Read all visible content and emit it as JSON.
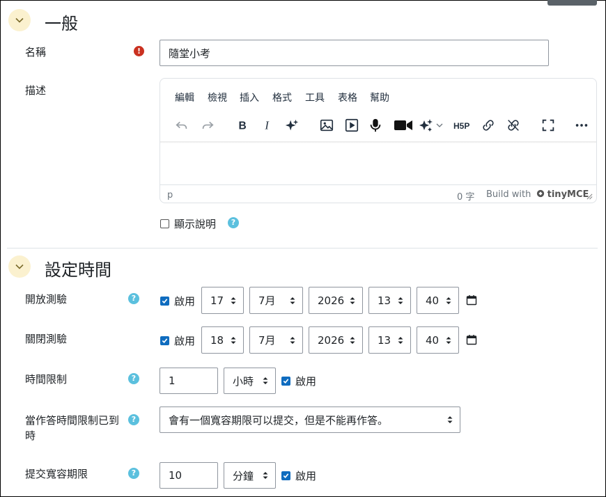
{
  "sections": {
    "general": {
      "title": "一般"
    },
    "timing": {
      "title": "設定時間"
    }
  },
  "fields": {
    "name": {
      "label": "名稱",
      "value": "隨堂小考",
      "required_icon": "exclamation-icon"
    },
    "description": {
      "label": "描述"
    },
    "show_description": {
      "label": "顯示說明",
      "checked": false
    },
    "open_quiz": {
      "label": "開放測驗",
      "enable_label": "啟用",
      "enabled": true,
      "day": "17",
      "month": "7月",
      "year": "2026",
      "hour": "13",
      "minute": "40"
    },
    "close_quiz": {
      "label": "關閉測驗",
      "enable_label": "啟用",
      "enabled": true,
      "day": "18",
      "month": "7月",
      "year": "2026",
      "hour": "13",
      "minute": "40"
    },
    "time_limit": {
      "label": "時間限制",
      "value": "1",
      "unit": "小時",
      "enable_label": "啟用",
      "enabled": true
    },
    "when_time_expires": {
      "label_line1": "當作答時間限制已到",
      "label_line2": "時",
      "value": "會有一個寬容期限可以提交，但是不能再作答。"
    },
    "grace_period": {
      "label": "提交寬容期限",
      "value": "10",
      "unit": "分鐘",
      "enable_label": "啟用",
      "enabled": true
    }
  },
  "editor": {
    "menu": [
      "編輯",
      "檢視",
      "插入",
      "格式",
      "工具",
      "表格",
      "幫助"
    ],
    "toolbar_icons": [
      "undo-icon",
      "redo-icon",
      "bold-icon",
      "italic-icon",
      "ai-sparkle-icon",
      "image-icon",
      "media-icon",
      "microphone-icon",
      "video-camera-icon",
      "ai-sparkles-dropdown-icon",
      "h5p-icon",
      "link-icon",
      "unlink-icon",
      "fullscreen-icon",
      "more-icon"
    ],
    "status_path": "p",
    "word_count": "0 字",
    "brand_prefix": "Build with",
    "brand_name": "tinyMCE"
  },
  "colors": {
    "accent": "#0f6cbf",
    "help": "#5bc0de",
    "required": "#ca3120",
    "toggle_bg": "#fbf1cf"
  }
}
